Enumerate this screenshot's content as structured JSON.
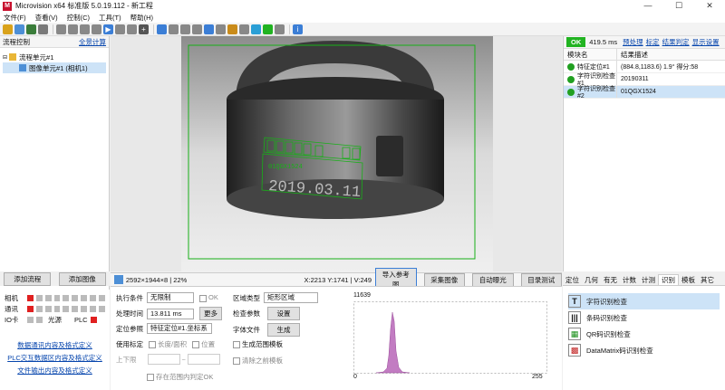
{
  "title": "Microvision x64 标准版 5.0.19.112 - 新工程",
  "menu": [
    "文件(F)",
    "查看(V)",
    "控制(C)",
    "工具(T)",
    "帮助(H)"
  ],
  "left": {
    "header": "流程控制",
    "expand_all": "全景计算",
    "tree_root": "流程单元#1",
    "tree_child": "图像单元#1 (相机1)",
    "add_flow": "添加流程",
    "add_image": "添加图像",
    "status": {
      "camera": "相机",
      "comm": "通讯",
      "io": "IO卡",
      "light": "光源",
      "plc": "PLC"
    },
    "links": [
      "数据通讯内容及格式定义",
      "PLC交互数据区内容及格式定义",
      "文件输出内容及格式定义"
    ]
  },
  "imagebar": {
    "size": "2592×1944×8 | 22%",
    "coords": "X:2213 Y:1741 | V:249",
    "btn_ref": "导入参考图",
    "btn_capture": "采集图像",
    "btn_exposure": "自动曝光",
    "btn_target": "目录测试"
  },
  "ocr_text": {
    "top": "01QGX1524",
    "bottom": "2019.03.11"
  },
  "params": {
    "exec_label": "执行条件",
    "exec_value": "无限制",
    "ok_label": "OK",
    "time_label": "处理时间",
    "time_value": "13.811 ms",
    "more": "更多",
    "locate_label": "定位参照",
    "locate_value": "特征定位#1.坐标系",
    "use_label": "使用标定",
    "opt1": "长度/面积",
    "opt2": "位置",
    "limit_label": "上下限",
    "tilde": "~",
    "within": "存在范围内判定OK",
    "region_type_label": "区域类型",
    "region_type_value": "矩形区域",
    "check_params": "检查参数",
    "set_btn": "设置",
    "font_file": "字体文件",
    "gen_btn": "生成",
    "gen_range": "生成范围模板",
    "clear_prev": "清除之前模板"
  },
  "histogram": {
    "max": "11639",
    "x_min": "0",
    "x_max": "255"
  },
  "right": {
    "status": "OK",
    "time": "419.5 ms",
    "links": [
      "预处理",
      "标定",
      "结果判定",
      "显示设置"
    ],
    "col1": "模块名",
    "col2": "结果描述",
    "rows": [
      {
        "name": "特征定位#1",
        "result": "(884.8,1183.6) 1.9° 得分:58"
      },
      {
        "name": "字符识别检查#1",
        "result": "20190311"
      },
      {
        "name": "字符识别检查#2",
        "result": "01QGX1524"
      }
    ]
  },
  "tabs": [
    "定位",
    "几何",
    "有无",
    "计数",
    "计测",
    "识别",
    "模板",
    "其它"
  ],
  "tools": [
    "字符识别检查",
    "条码识别检查",
    "QR码识别检查",
    "DataMatrix码识别检查"
  ]
}
